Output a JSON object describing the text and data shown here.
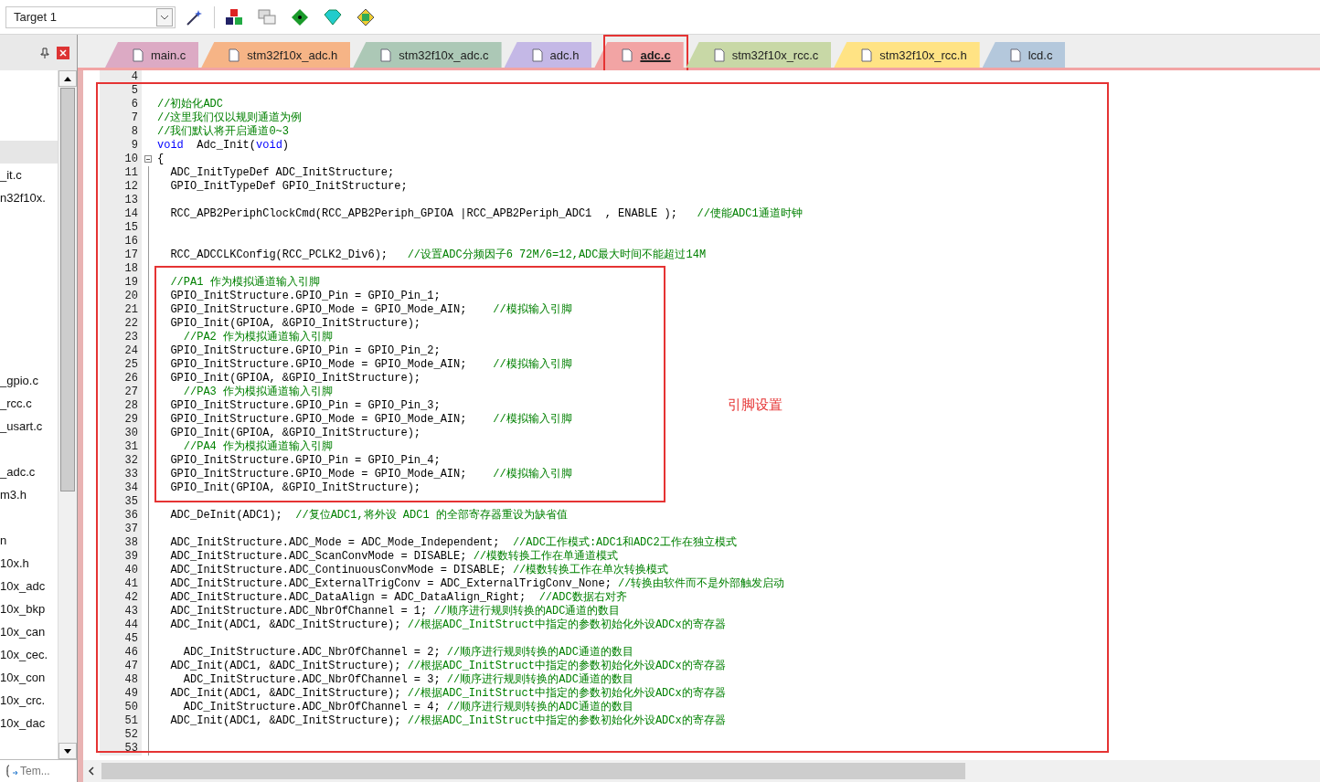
{
  "toolbar": {
    "target": "Target 1"
  },
  "tabs": [
    {
      "label": "main.c",
      "color": "#dcaac4",
      "selected": false
    },
    {
      "label": "stm32f10x_adc.h",
      "color": "#f6b486",
      "selected": false
    },
    {
      "label": "stm32f10x_adc.c",
      "color": "#acc8b6",
      "selected": false
    },
    {
      "label": "adc.h",
      "color": "#c4b8e6",
      "selected": false
    },
    {
      "label": "adc.c",
      "color": "#f2a4a4",
      "selected": true
    },
    {
      "label": "stm32f10x_rcc.c",
      "color": "#c8d8a6",
      "selected": false
    },
    {
      "label": "stm32f10x_rcc.h",
      "color": "#ffe384",
      "selected": false
    },
    {
      "label": "lcd.c",
      "color": "#b4c8dc",
      "selected": false
    }
  ],
  "project_panel": {
    "rows": [
      {
        "kind": "blank",
        "selected": false
      },
      {
        "kind": "blank",
        "selected": false
      },
      {
        "kind": "blank",
        "selected": false
      },
      {
        "kind": "blank",
        "selected": true
      },
      {
        "kind": "file",
        "text": "_it.c",
        "selected": false
      },
      {
        "kind": "file",
        "text": "n32f10x.",
        "selected": false
      },
      {
        "kind": "blank",
        "selected": false
      },
      {
        "kind": "blank",
        "selected": false
      },
      {
        "kind": "blank",
        "selected": false
      },
      {
        "kind": "blank",
        "selected": false
      },
      {
        "kind": "blank",
        "selected": false
      },
      {
        "kind": "blank",
        "selected": false
      },
      {
        "kind": "blank",
        "selected": false
      },
      {
        "kind": "file",
        "text": "_gpio.c",
        "selected": false
      },
      {
        "kind": "file",
        "text": "_rcc.c",
        "selected": false
      },
      {
        "kind": "file",
        "text": "_usart.c",
        "selected": false
      },
      {
        "kind": "blank",
        "selected": false
      },
      {
        "kind": "file",
        "text": "_adc.c",
        "selected": false
      },
      {
        "kind": "file",
        "text": "m3.h",
        "selected": false
      },
      {
        "kind": "blank",
        "selected": false
      },
      {
        "kind": "file",
        "text": "n",
        "selected": false
      },
      {
        "kind": "file",
        "text": "10x.h",
        "selected": false
      },
      {
        "kind": "file",
        "text": "10x_adc",
        "selected": false
      },
      {
        "kind": "file",
        "text": "10x_bkp",
        "selected": false
      },
      {
        "kind": "file",
        "text": "10x_can",
        "selected": false
      },
      {
        "kind": "file",
        "text": "10x_cec.",
        "selected": false
      },
      {
        "kind": "file",
        "text": "10x_con",
        "selected": false
      },
      {
        "kind": "file",
        "text": "10x_crc.",
        "selected": false
      },
      {
        "kind": "file",
        "text": "10x_dac",
        "selected": false
      }
    ],
    "bottom_tab": "Tem..."
  },
  "editor": {
    "annotation": "引脚设置",
    "lines": [
      {
        "n": "4"
      },
      {
        "n": "5"
      },
      {
        "n": "6",
        "segments": [
          {
            "kind": "comment",
            "text": "//初始化ADC"
          }
        ]
      },
      {
        "n": "7",
        "segments": [
          {
            "kind": "comment",
            "text": "//这里我们仅以规则通道为例"
          }
        ]
      },
      {
        "n": "8",
        "segments": [
          {
            "kind": "comment",
            "text": "//我们默认将开启通道0~3"
          }
        ]
      },
      {
        "n": "9",
        "segments": [
          {
            "kind": "keyword",
            "text": "void"
          },
          {
            "kind": "code",
            "text": "  Adc_Init("
          },
          {
            "kind": "keyword",
            "text": "void"
          },
          {
            "kind": "code",
            "text": ")"
          }
        ]
      },
      {
        "n": "10",
        "expanded": true,
        "segments": [
          {
            "kind": "code",
            "text": "{"
          }
        ]
      },
      {
        "n": "11",
        "segments": [
          {
            "kind": "code",
            "text": "  ADC_InitTypeDef ADC_InitStructure;"
          }
        ]
      },
      {
        "n": "12",
        "segments": [
          {
            "kind": "code",
            "text": "  GPIO_InitTypeDef GPIO_InitStructure;"
          }
        ]
      },
      {
        "n": "13"
      },
      {
        "n": "14",
        "segments": [
          {
            "kind": "code",
            "text": "  RCC_APB2PeriphClockCmd(RCC_APB2Periph_GPIOA |RCC_APB2Periph_ADC1  , ENABLE );   "
          },
          {
            "kind": "comment",
            "text": "//使能ADC1通道时钟"
          }
        ]
      },
      {
        "n": "15"
      },
      {
        "n": "16"
      },
      {
        "n": "17",
        "segments": [
          {
            "kind": "code",
            "text": "  RCC_ADCCLKConfig(RCC_PCLK2_Div6);   "
          },
          {
            "kind": "comment",
            "text": "//设置ADC分频因子6 72M/6=12,ADC最大时间不能超过14M"
          }
        ]
      },
      {
        "n": "18"
      },
      {
        "n": "19",
        "segments": [
          {
            "kind": "comment",
            "text": "  //PA1 作为模拟通道输入引脚"
          }
        ]
      },
      {
        "n": "20",
        "segments": [
          {
            "kind": "code",
            "text": "  GPIO_InitStructure.GPIO_Pin = GPIO_Pin_1;"
          }
        ]
      },
      {
        "n": "21",
        "segments": [
          {
            "kind": "code",
            "text": "  GPIO_InitStructure.GPIO_Mode = GPIO_Mode_AIN;    "
          },
          {
            "kind": "comment",
            "text": "//模拟输入引脚"
          }
        ]
      },
      {
        "n": "22",
        "segments": [
          {
            "kind": "code",
            "text": "  GPIO_Init(GPIOA, &GPIO_InitStructure);"
          }
        ]
      },
      {
        "n": "23",
        "segments": [
          {
            "kind": "comment",
            "text": "    //PA2 作为模拟通道输入引脚"
          }
        ]
      },
      {
        "n": "24",
        "segments": [
          {
            "kind": "code",
            "text": "  GPIO_InitStructure.GPIO_Pin = GPIO_Pin_2;"
          }
        ]
      },
      {
        "n": "25",
        "segments": [
          {
            "kind": "code",
            "text": "  GPIO_InitStructure.GPIO_Mode = GPIO_Mode_AIN;    "
          },
          {
            "kind": "comment",
            "text": "//模拟输入引脚"
          }
        ]
      },
      {
        "n": "26",
        "segments": [
          {
            "kind": "code",
            "text": "  GPIO_Init(GPIOA, &GPIO_InitStructure);"
          }
        ]
      },
      {
        "n": "27",
        "segments": [
          {
            "kind": "comment",
            "text": "    //PA3 作为模拟通道输入引脚"
          }
        ]
      },
      {
        "n": "28",
        "segments": [
          {
            "kind": "code",
            "text": "  GPIO_InitStructure.GPIO_Pin = GPIO_Pin_3;"
          }
        ]
      },
      {
        "n": "29",
        "segments": [
          {
            "kind": "code",
            "text": "  GPIO_InitStructure.GPIO_Mode = GPIO_Mode_AIN;    "
          },
          {
            "kind": "comment",
            "text": "//模拟输入引脚"
          }
        ]
      },
      {
        "n": "30",
        "segments": [
          {
            "kind": "code",
            "text": "  GPIO_Init(GPIOA, &GPIO_InitStructure);"
          }
        ]
      },
      {
        "n": "31",
        "segments": [
          {
            "kind": "comment",
            "text": "    //PA4 作为模拟通道输入引脚"
          }
        ]
      },
      {
        "n": "32",
        "segments": [
          {
            "kind": "code",
            "text": "  GPIO_InitStructure.GPIO_Pin = GPIO_Pin_4;"
          }
        ]
      },
      {
        "n": "33",
        "segments": [
          {
            "kind": "code",
            "text": "  GPIO_InitStructure.GPIO_Mode = GPIO_Mode_AIN;    "
          },
          {
            "kind": "comment",
            "text": "//模拟输入引脚"
          }
        ]
      },
      {
        "n": "34",
        "segments": [
          {
            "kind": "code",
            "text": "  GPIO_Init(GPIOA, &GPIO_InitStructure);"
          }
        ]
      },
      {
        "n": "35"
      },
      {
        "n": "36",
        "segments": [
          {
            "kind": "code",
            "text": "  ADC_DeInit(ADC1);  "
          },
          {
            "kind": "comment",
            "text": "//复位ADC1,将外设 ADC1 的全部寄存器重设为缺省值"
          }
        ]
      },
      {
        "n": "37"
      },
      {
        "n": "38",
        "segments": [
          {
            "kind": "code",
            "text": "  ADC_InitStructure.ADC_Mode = ADC_Mode_Independent;  "
          },
          {
            "kind": "comment",
            "text": "//ADC工作模式:ADC1和ADC2工作在独立模式"
          }
        ]
      },
      {
        "n": "39",
        "segments": [
          {
            "kind": "code",
            "text": "  ADC_InitStructure.ADC_ScanConvMode = DISABLE; "
          },
          {
            "kind": "comment",
            "text": "//模数转换工作在单通道模式"
          }
        ]
      },
      {
        "n": "40",
        "segments": [
          {
            "kind": "code",
            "text": "  ADC_InitStructure.ADC_ContinuousConvMode = DISABLE; "
          },
          {
            "kind": "comment",
            "text": "//模数转换工作在单次转换模式"
          }
        ]
      },
      {
        "n": "41",
        "segments": [
          {
            "kind": "code",
            "text": "  ADC_InitStructure.ADC_ExternalTrigConv = ADC_ExternalTrigConv_None; "
          },
          {
            "kind": "comment",
            "text": "//转换由软件而不是外部触发启动"
          }
        ]
      },
      {
        "n": "42",
        "segments": [
          {
            "kind": "code",
            "text": "  ADC_InitStructure.ADC_DataAlign = ADC_DataAlign_Right;  "
          },
          {
            "kind": "comment",
            "text": "//ADC数据右对齐"
          }
        ]
      },
      {
        "n": "43",
        "segments": [
          {
            "kind": "code",
            "text": "  ADC_InitStructure.ADC_NbrOfChannel = 1; "
          },
          {
            "kind": "comment",
            "text": "//顺序进行规则转换的ADC通道的数目"
          }
        ]
      },
      {
        "n": "44",
        "segments": [
          {
            "kind": "code",
            "text": "  ADC_Init(ADC1, &ADC_InitStructure); "
          },
          {
            "kind": "comment",
            "text": "//根据ADC_InitStruct中指定的参数初始化外设ADCx的寄存器"
          }
        ]
      },
      {
        "n": "45"
      },
      {
        "n": "46",
        "segments": [
          {
            "kind": "code",
            "text": "    ADC_InitStructure.ADC_NbrOfChannel = 2; "
          },
          {
            "kind": "comment",
            "text": "//顺序进行规则转换的ADC通道的数目"
          }
        ]
      },
      {
        "n": "47",
        "segments": [
          {
            "kind": "code",
            "text": "  ADC_Init(ADC1, &ADC_InitStructure); "
          },
          {
            "kind": "comment",
            "text": "//根据ADC_InitStruct中指定的参数初始化外设ADCx的寄存器"
          }
        ]
      },
      {
        "n": "48",
        "segments": [
          {
            "kind": "code",
            "text": "    ADC_InitStructure.ADC_NbrOfChannel = 3; "
          },
          {
            "kind": "comment",
            "text": "//顺序进行规则转换的ADC通道的数目"
          }
        ]
      },
      {
        "n": "49",
        "segments": [
          {
            "kind": "code",
            "text": "  ADC_Init(ADC1, &ADC_InitStructure); "
          },
          {
            "kind": "comment",
            "text": "//根据ADC_InitStruct中指定的参数初始化外设ADCx的寄存器"
          }
        ]
      },
      {
        "n": "50",
        "segments": [
          {
            "kind": "code",
            "text": "    ADC_InitStructure.ADC_NbrOfChannel = 4; "
          },
          {
            "kind": "comment",
            "text": "//顺序进行规则转换的ADC通道的数目"
          }
        ]
      },
      {
        "n": "51",
        "segments": [
          {
            "kind": "code",
            "text": "  ADC_Init(ADC1, &ADC_InitStructure); "
          },
          {
            "kind": "comment",
            "text": "//根据ADC_InitStruct中指定的参数初始化外设ADCx的寄存器"
          }
        ]
      },
      {
        "n": "52"
      },
      {
        "n": "53"
      }
    ]
  }
}
